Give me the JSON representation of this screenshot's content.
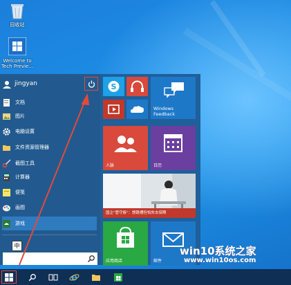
{
  "desktop": {
    "icons": [
      {
        "label": "回收站",
        "icon": "recycle-bin-icon"
      },
      {
        "label": "Welcome to Tech Previe...",
        "icon": "windows-logo-icon"
      }
    ]
  },
  "start_menu": {
    "user_name": "jingyan",
    "items": [
      {
        "label": "文档",
        "icon": "document-icon"
      },
      {
        "label": "图片",
        "icon": "pictures-icon"
      },
      {
        "label": "电脑设置",
        "icon": "gear-icon"
      },
      {
        "label": "文件资源管理器",
        "icon": "folder-icon"
      },
      {
        "label": "截图工具",
        "icon": "snipping-tool-icon"
      },
      {
        "label": "计算器",
        "icon": "calculator-icon"
      },
      {
        "label": "便笺",
        "icon": "sticky-notes-icon"
      },
      {
        "label": "画图",
        "icon": "paint-icon"
      },
      {
        "label": "游戏",
        "icon": "games-icon"
      }
    ],
    "search_placeholder": "",
    "tiles": {
      "windows_feedback": "Windows Feedback",
      "people": "人脉",
      "calendar": "日历",
      "news_caption": "国企\"管守族\"：想跳槽但怕失去保障",
      "store": "应用商店",
      "mail": "邮件"
    },
    "colors": {
      "accent": "#2a74b8",
      "red": "#d9493c",
      "blue": "#1e78c8",
      "green": "#2aa843"
    }
  },
  "ime_label": "中",
  "watermark": {
    "title": "win10系统之家",
    "url": "www.win10os.com"
  },
  "taskbar": {
    "icons": [
      "windows-logo-icon",
      "search-icon",
      "task-view-icon",
      "ie-icon",
      "file-explorer-icon",
      "store-icon"
    ]
  }
}
